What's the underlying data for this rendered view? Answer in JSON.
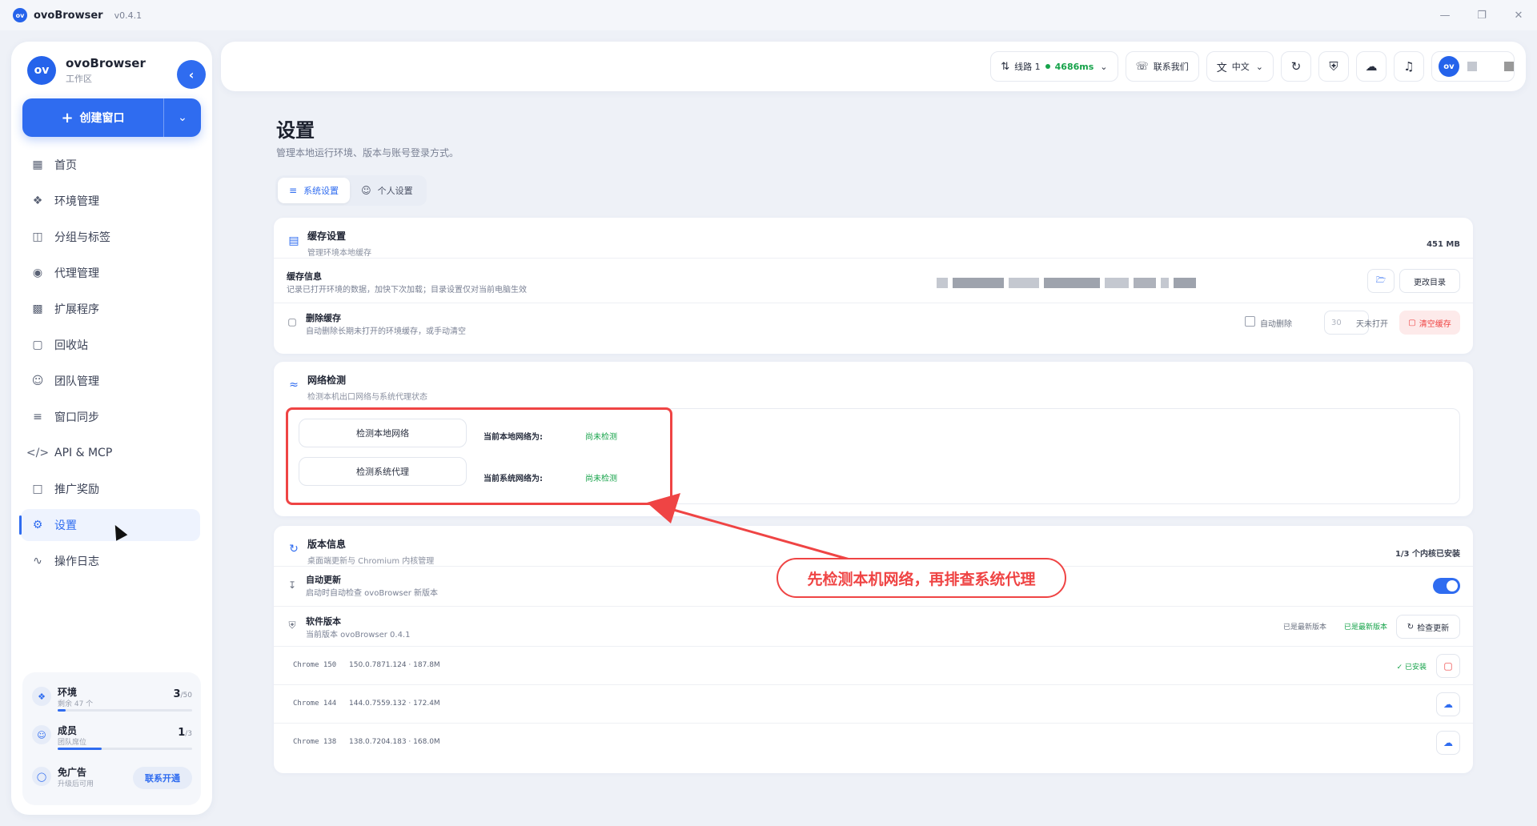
{
  "app": {
    "name": "ovoBrowser",
    "version": "v0.4.1"
  },
  "sidebar": {
    "brand_name": "ovoBrowser",
    "brand_sub": "工作区",
    "create_label": "创建窗口",
    "items": [
      {
        "label": "首页",
        "icon": "grid-icon"
      },
      {
        "label": "环境管理",
        "icon": "cubes-icon"
      },
      {
        "label": "分组与标签",
        "icon": "folder-icon"
      },
      {
        "label": "代理管理",
        "icon": "globe-icon"
      },
      {
        "label": "扩展程序",
        "icon": "puzzle-icon"
      },
      {
        "label": "回收站",
        "icon": "trash-icon"
      },
      {
        "label": "团队管理",
        "icon": "users-icon"
      },
      {
        "label": "窗口同步",
        "icon": "sliders-icon"
      },
      {
        "label": "API & MCP",
        "icon": "code-icon"
      },
      {
        "label": "推广奖励",
        "icon": "gift-icon"
      },
      {
        "label": "设置",
        "icon": "gear-icon",
        "active": true
      },
      {
        "label": "操作日志",
        "icon": "activity-icon"
      }
    ],
    "usage": {
      "env_title": "环境",
      "env_sub": "剩余 47 个",
      "env_used": "3",
      "env_total": "/50",
      "env_progress": 0.06,
      "member_title": "成员",
      "member_sub": "团队席位",
      "member_used": "1",
      "member_total": "/3",
      "member_progress": 0.33,
      "ad_title": "免广告",
      "ad_sub": "升级后可用",
      "ad_button": "联系开通"
    }
  },
  "topbar": {
    "line_label": "线路 1",
    "latency": "4686ms",
    "contact_label": "联系我们",
    "lang_label": "中文"
  },
  "page": {
    "title": "设置",
    "subtitle": "管理本地运行环境、版本与账号登录方式。",
    "tabs": [
      {
        "label": "系统设置",
        "active": true
      },
      {
        "label": "个人设置"
      }
    ]
  },
  "cache": {
    "title": "缓存设置",
    "desc": "管理环境本地缓存",
    "size": "451 MB",
    "info_title": "缓存信息",
    "info_desc": "记录已打开环境的数据，加快下次加载；目录设置仅对当前电脑生效",
    "change_dir": "更改目录",
    "delete_title": "删除缓存",
    "delete_desc": "自动删除长期未打开的环境缓存，或手动清空",
    "auto_delete": "自动删除",
    "days_placeholder": "30",
    "days_suffix": "天未打开",
    "clear_button": "清空缓存"
  },
  "network": {
    "title": "网络检测",
    "desc": "检测本机出口网络与系统代理状态",
    "check_local": "检测本地网络",
    "check_proxy": "检测系统代理",
    "local_label": "当前本地网络为:",
    "proxy_label": "当前系统网络为:",
    "local_status": "尚未检测",
    "proxy_status": "尚未检测"
  },
  "version": {
    "title": "版本信息",
    "desc": "桌面端更新与 Chromium 内核管理",
    "kernel_count": "1/3 个内核已安装",
    "auto_update_title": "自动更新",
    "auto_update_desc": "启动时自动检查 ovoBrowser 新版本",
    "software_title": "软件版本",
    "software_desc": "当前版本 ovoBrowser 0.4.1",
    "latest_gray": "已是最新版本",
    "latest_green": "已是最新版本",
    "check_update": "检查更新",
    "installed": "已安装",
    "kernels": [
      {
        "name": "Chrome 150",
        "info": "150.0.7871.124 · 187.8M"
      },
      {
        "name": "Chrome 144",
        "info": "144.0.7559.132 · 172.4M"
      },
      {
        "name": "Chrome 138",
        "info": "138.0.7204.183 · 168.0M"
      }
    ]
  },
  "annotation": {
    "text": "先检测本机网络，再排查系统代理"
  },
  "colors": {
    "accent": "#2f6cf0",
    "danger": "#ef4444",
    "success": "#16a34a"
  }
}
